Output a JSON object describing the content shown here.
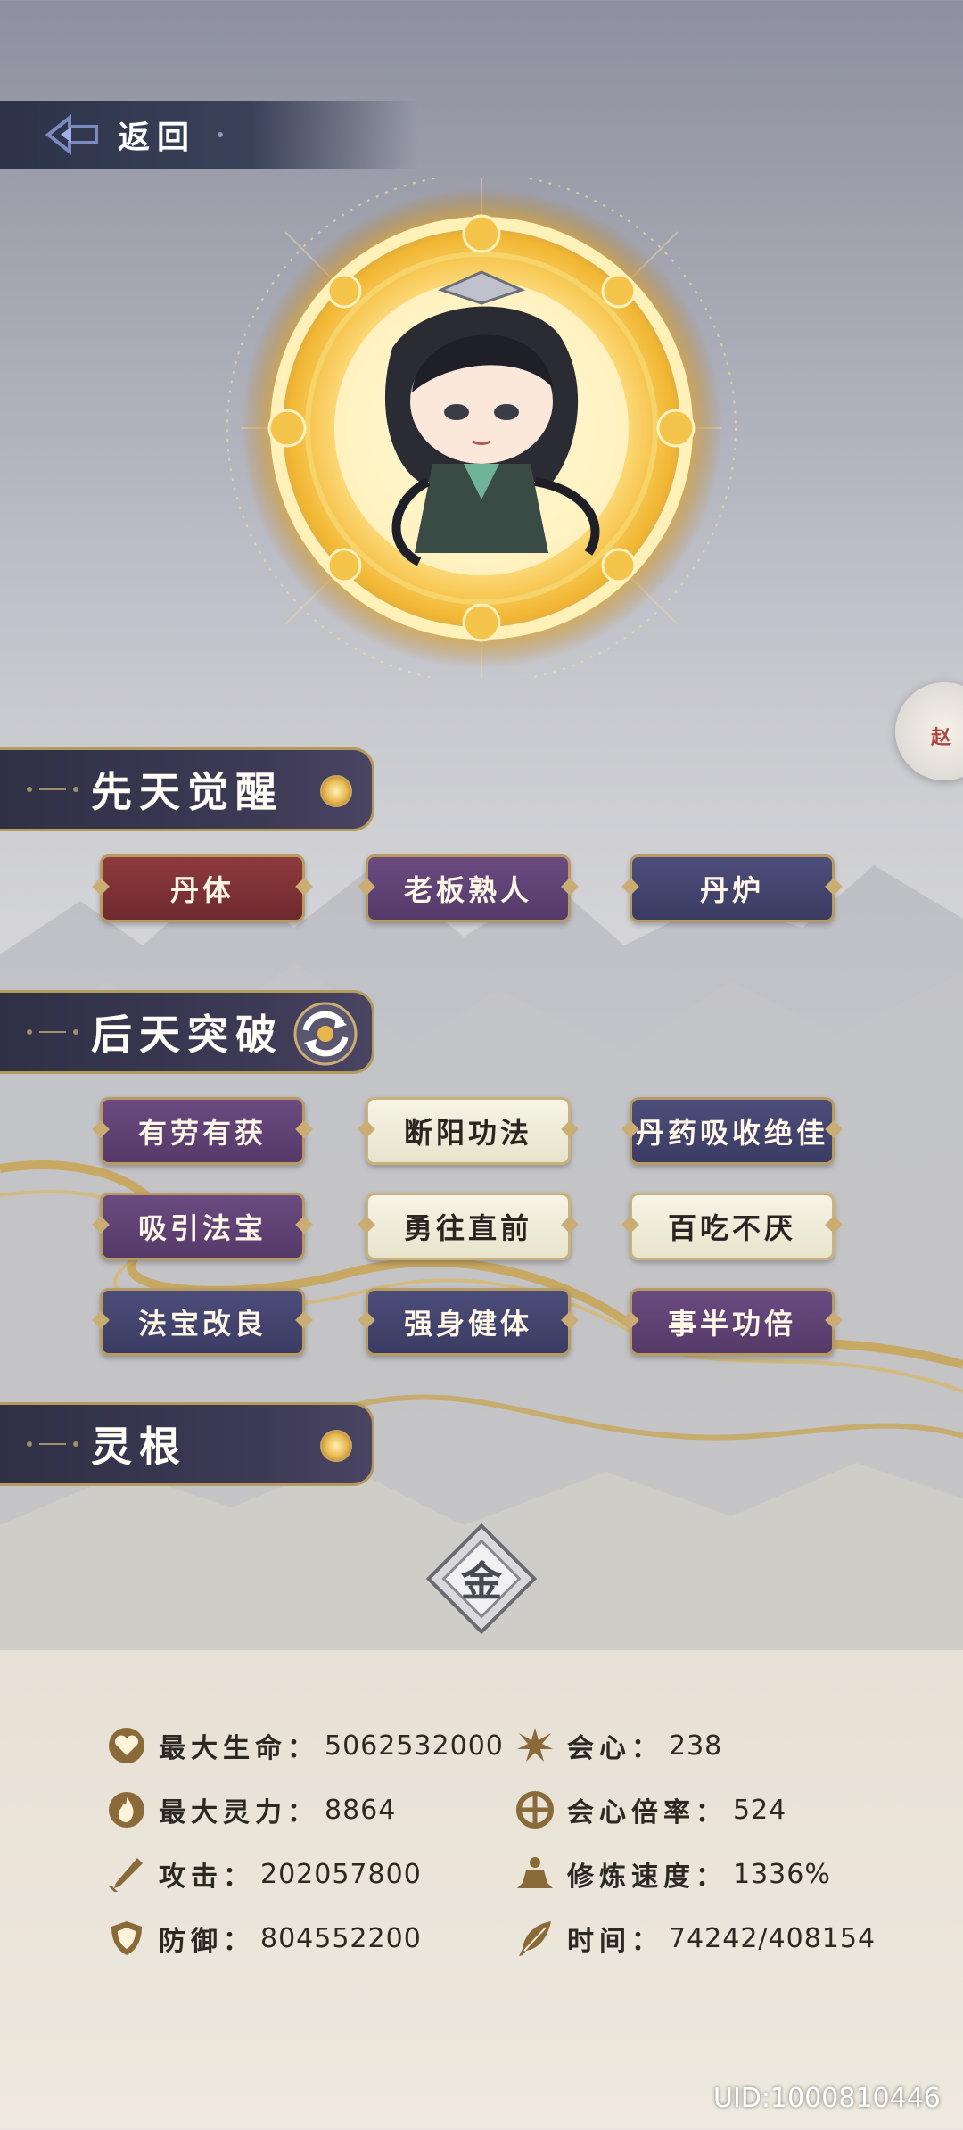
{
  "nav": {
    "back_label": "返回"
  },
  "side_button": {
    "label": "赵"
  },
  "innate": {
    "title": "先天觉醒",
    "talents": [
      {
        "label": "丹体",
        "color": "red"
      },
      {
        "label": "老板熟人",
        "color": "purple"
      },
      {
        "label": "丹炉",
        "color": "navy"
      }
    ]
  },
  "acquired": {
    "title": "后天突破",
    "talents": [
      {
        "label": "有劳有获",
        "color": "purple"
      },
      {
        "label": "断阳功法",
        "color": "light"
      },
      {
        "label": "丹药吸收绝佳",
        "color": "navy"
      },
      {
        "label": "吸引法宝",
        "color": "purple"
      },
      {
        "label": "勇往直前",
        "color": "light"
      },
      {
        "label": "百吃不厌",
        "color": "light"
      },
      {
        "label": "法宝改良",
        "color": "navy"
      },
      {
        "label": "强身健体",
        "color": "navy"
      },
      {
        "label": "事半功倍",
        "color": "purple"
      }
    ]
  },
  "spirit_root": {
    "title": "灵根",
    "element": "金"
  },
  "stats": {
    "max_hp": {
      "label": "最大生命：",
      "value": "5062532000",
      "icon": "heart-icon"
    },
    "max_spirit": {
      "label": "最大灵力：",
      "value": "8864",
      "icon": "flame-icon"
    },
    "attack": {
      "label": "攻击：",
      "value": "202057800",
      "icon": "sword-icon"
    },
    "defense": {
      "label": "防御：",
      "value": "804552200",
      "icon": "shield-icon"
    },
    "crit": {
      "label": "会心：",
      "value": "238",
      "icon": "burst-icon"
    },
    "crit_mult": {
      "label": "会心倍率：",
      "value": "524",
      "icon": "target-icon"
    },
    "cultivation_speed": {
      "label": "修炼速度：",
      "value": "1336%",
      "icon": "meditation-icon"
    },
    "time": {
      "label": "时间：",
      "value": "74242/408154",
      "icon": "feather-icon"
    }
  },
  "uid": "UID:1000810446",
  "colors": {
    "gold": "#b59a5e",
    "header_bg": "#2f3046",
    "talent_red": "#8e3a3c",
    "talent_purple": "#6b4a80",
    "talent_navy": "#4c4d7a",
    "talent_light": "#f6f4e6"
  }
}
